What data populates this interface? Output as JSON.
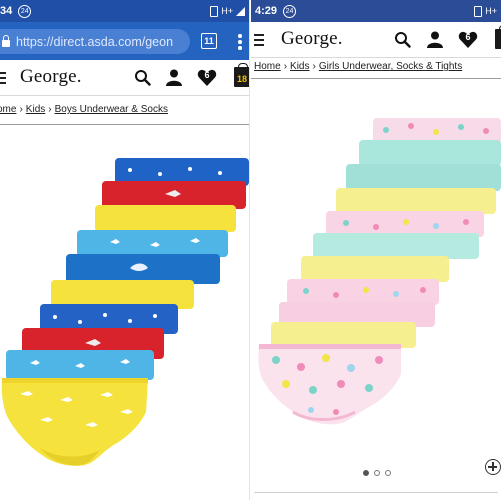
{
  "left": {
    "status": {
      "time": "34",
      "notif": "24",
      "signal": "H+"
    },
    "browser": {
      "url": "https://direct.asda.com/geon",
      "tab_count": "11"
    },
    "header": {
      "logo": "George.",
      "wishlist_count": "6",
      "bag_count": "18"
    },
    "breadcrumb": [
      "ome",
      "Kids",
      "Boys Underwear & Socks"
    ],
    "product": {
      "name": "boys-briefs-10-pack",
      "colors": [
        "#1f63c7",
        "#d9232c",
        "#f5e23c",
        "#4fb4e6"
      ]
    }
  },
  "right": {
    "status": {
      "time": "4:29",
      "notif": "24",
      "signal": "H+"
    },
    "header": {
      "logo": "George.",
      "wishlist_count": "6"
    },
    "breadcrumb": [
      "Home",
      "Kids",
      "Girls Underwear, Socks & Tights"
    ],
    "product": {
      "name": "girls-briefs-10-pack",
      "colors": [
        "#f6c8dc",
        "#a9e6dc",
        "#f6ef90",
        "#f9d7e6"
      ]
    },
    "carousel": {
      "count": 3,
      "active": 0
    }
  }
}
